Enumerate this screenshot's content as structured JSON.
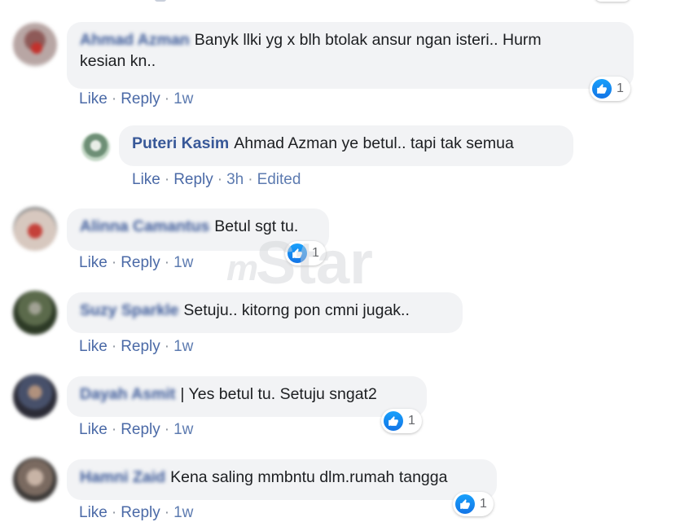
{
  "actions": {
    "like_label": "Like",
    "reply_label": "Reply",
    "sep": "·",
    "edited_label": "Edited"
  },
  "watermark": {
    "text": "Star",
    "prefix": "m"
  },
  "comments": [
    {
      "author": "Ahmad Azman",
      "text": "Banyk llki yg x blh btolak ansur ngan isteri.. Hurm",
      "text_line2": "kesian kn..",
      "time": "1w",
      "reactions": "1",
      "avatar_colors": [
        "#b8a6a4",
        "#8e5a58",
        "#c3312c"
      ]
    },
    {
      "author": "Puteri Kasim",
      "text": "Ahmad Azman ye betul.. tapi tak semua",
      "time": "3h",
      "avatar_colors": [
        "#c2d6c4",
        "#6e8f76",
        "#e9eee7"
      ]
    },
    {
      "author": "Alinna Camantus",
      "text": "Betul sgt tu.",
      "time": "1w",
      "reactions": "1",
      "avatar_colors": [
        "#d7c8bf",
        "#c5413a",
        "#6b6b6b"
      ]
    },
    {
      "author": "Suzy Sparkle",
      "text": "Setuju.. kitorng pon cmni jugak..",
      "time": "1w",
      "avatar_colors": [
        "#2d3a26",
        "#5b6a4b",
        "#a1a294"
      ]
    },
    {
      "author": "Dayah Asmit",
      "text": "| Yes betul tu. Setuju sngat2",
      "time": "1w",
      "reactions": "1",
      "avatar_colors": [
        "#2b2b36",
        "#47506a",
        "#b0917d"
      ]
    },
    {
      "author": "Hamni Zaid",
      "text": "Kena saling mmbntu dlm.rumah tangga",
      "time": "1w",
      "reactions": "1",
      "avatar_colors": [
        "#7a6a60",
        "#3b3836",
        "#c8b4a6"
      ]
    }
  ]
}
